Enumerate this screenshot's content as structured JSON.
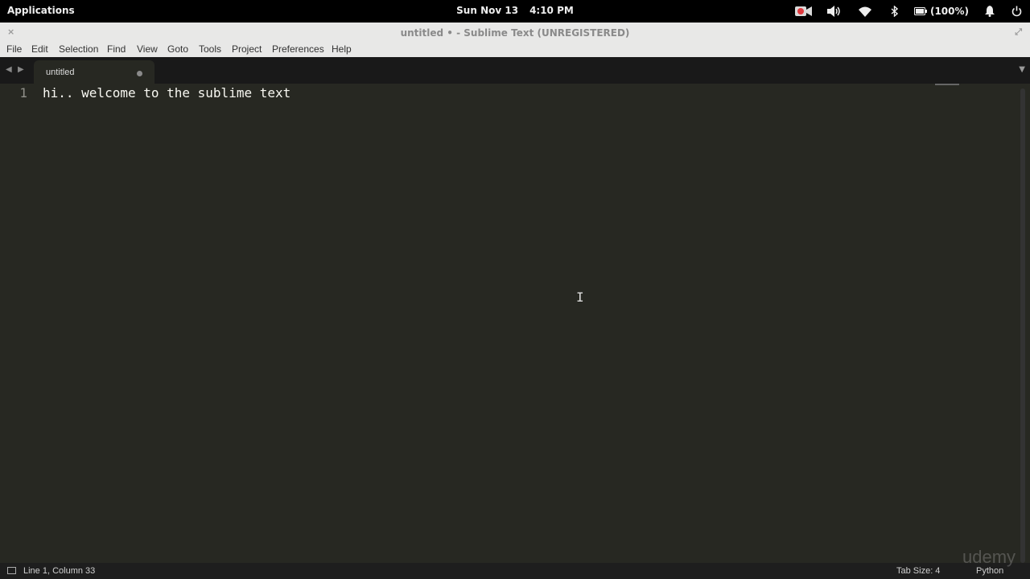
{
  "topbar": {
    "applications": "Applications",
    "date": "Sun Nov 13",
    "time": "4:10 PM",
    "battery": "(100%)",
    "icons": [
      "record-icon",
      "volume-icon",
      "wifi-icon",
      "bluetooth-icon",
      "battery-icon",
      "bell-icon",
      "power-icon"
    ]
  },
  "window": {
    "title": "untitled • - Sublime Text (UNREGISTERED)",
    "close_glyph": "×",
    "maximize_glyph": "⤢"
  },
  "menu": [
    "File",
    "Edit",
    "Selection",
    "Find",
    "View",
    "Goto",
    "Tools",
    "Project",
    "Preferences",
    "Help"
  ],
  "tabs": [
    {
      "label": "untitled",
      "modified": true
    }
  ],
  "editor": {
    "lines": [
      {
        "number": "1",
        "text": "hi.. welcome to the sublime text"
      }
    ]
  },
  "status": {
    "position": "Line 1, Column 33",
    "tab_size": "Tab Size: 4",
    "syntax": "Python"
  },
  "watermark": "udemy",
  "colors": {
    "editor_bg": "#272822",
    "text": "#f8f8f2",
    "gutter_text": "#90908a",
    "tabbar_bg": "#191919",
    "chrome_bg": "#e8e8e7",
    "record": "#e0393e"
  }
}
